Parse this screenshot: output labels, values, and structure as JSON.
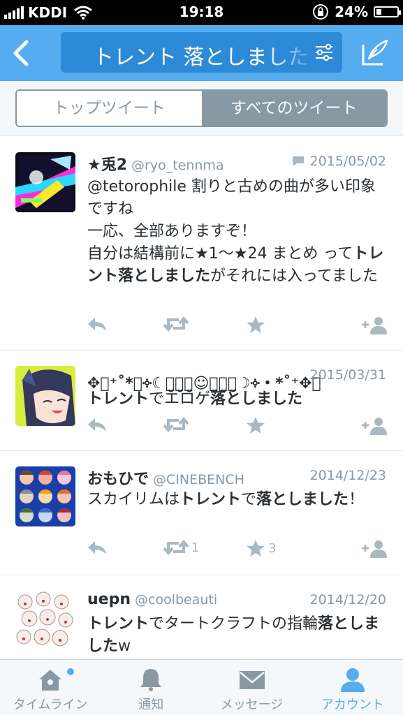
{
  "status": {
    "carrier": "KDDI",
    "time": "19:18",
    "battery": "24%",
    "battery_level": 0.24
  },
  "nav": {
    "search_query": "トレント 落としました"
  },
  "segments": {
    "top": "トップツイート",
    "all": "すべてのツイート"
  },
  "tweets": [
    {
      "name": "★兎2",
      "handle": "@ryo_tennma",
      "date": "2015/05/02",
      "has_conversation": true,
      "text": [
        {
          "t": "@tetorophile 割りと古めの曲が多い印象ですね\n一応、全部ありますぞ！\n自分は結構前に★1〜★24 まとめ って",
          "b": false
        },
        {
          "t": "トレント落としました",
          "b": true
        },
        {
          "t": "がそれには入ってました",
          "b": false
        }
      ],
      "retweets": "",
      "favorites": ""
    },
    {
      "name": "✥͙⁺˚*・༓☾ピ̤̮ラ̤̮フ̤̮☺︎セ̤̮ラ̤̮フ̤̮☽༓・*˚⁺✥͙",
      "handle": "",
      "date": "2015/03/31",
      "has_conversation": false,
      "text": [
        {
          "t": "トレント",
          "b": true
        },
        {
          "t": "でエロゲ",
          "b": false
        },
        {
          "t": "落としました",
          "b": true
        }
      ],
      "retweets": "",
      "favorites": ""
    },
    {
      "name": "おもひで",
      "handle": "@CINEBENCH",
      "date": "2014/12/23",
      "has_conversation": false,
      "text": [
        {
          "t": "スカイリムは",
          "b": false
        },
        {
          "t": "トレント",
          "b": true
        },
        {
          "t": "で",
          "b": false
        },
        {
          "t": "落としました",
          "b": true
        },
        {
          "t": "！",
          "b": false
        }
      ],
      "retweets": "1",
      "favorites": "3"
    },
    {
      "name": "uepn",
      "handle": "@coolbeauti",
      "date": "2014/12/20",
      "has_conversation": false,
      "text": [
        {
          "t": "トレント",
          "b": true
        },
        {
          "t": "でタートクラフトの指輪",
          "b": false
        },
        {
          "t": "落としました",
          "b": true
        },
        {
          "t": "w",
          "b": false
        }
      ],
      "retweets": "",
      "favorites": ""
    }
  ],
  "tabbar": {
    "timeline": "タイムライン",
    "notifications": "通知",
    "messages": "メッセージ",
    "account": "アカウント"
  },
  "colors": {
    "brand": "#55acee",
    "muted": "#8899a6",
    "icon": "#aab8c2"
  }
}
